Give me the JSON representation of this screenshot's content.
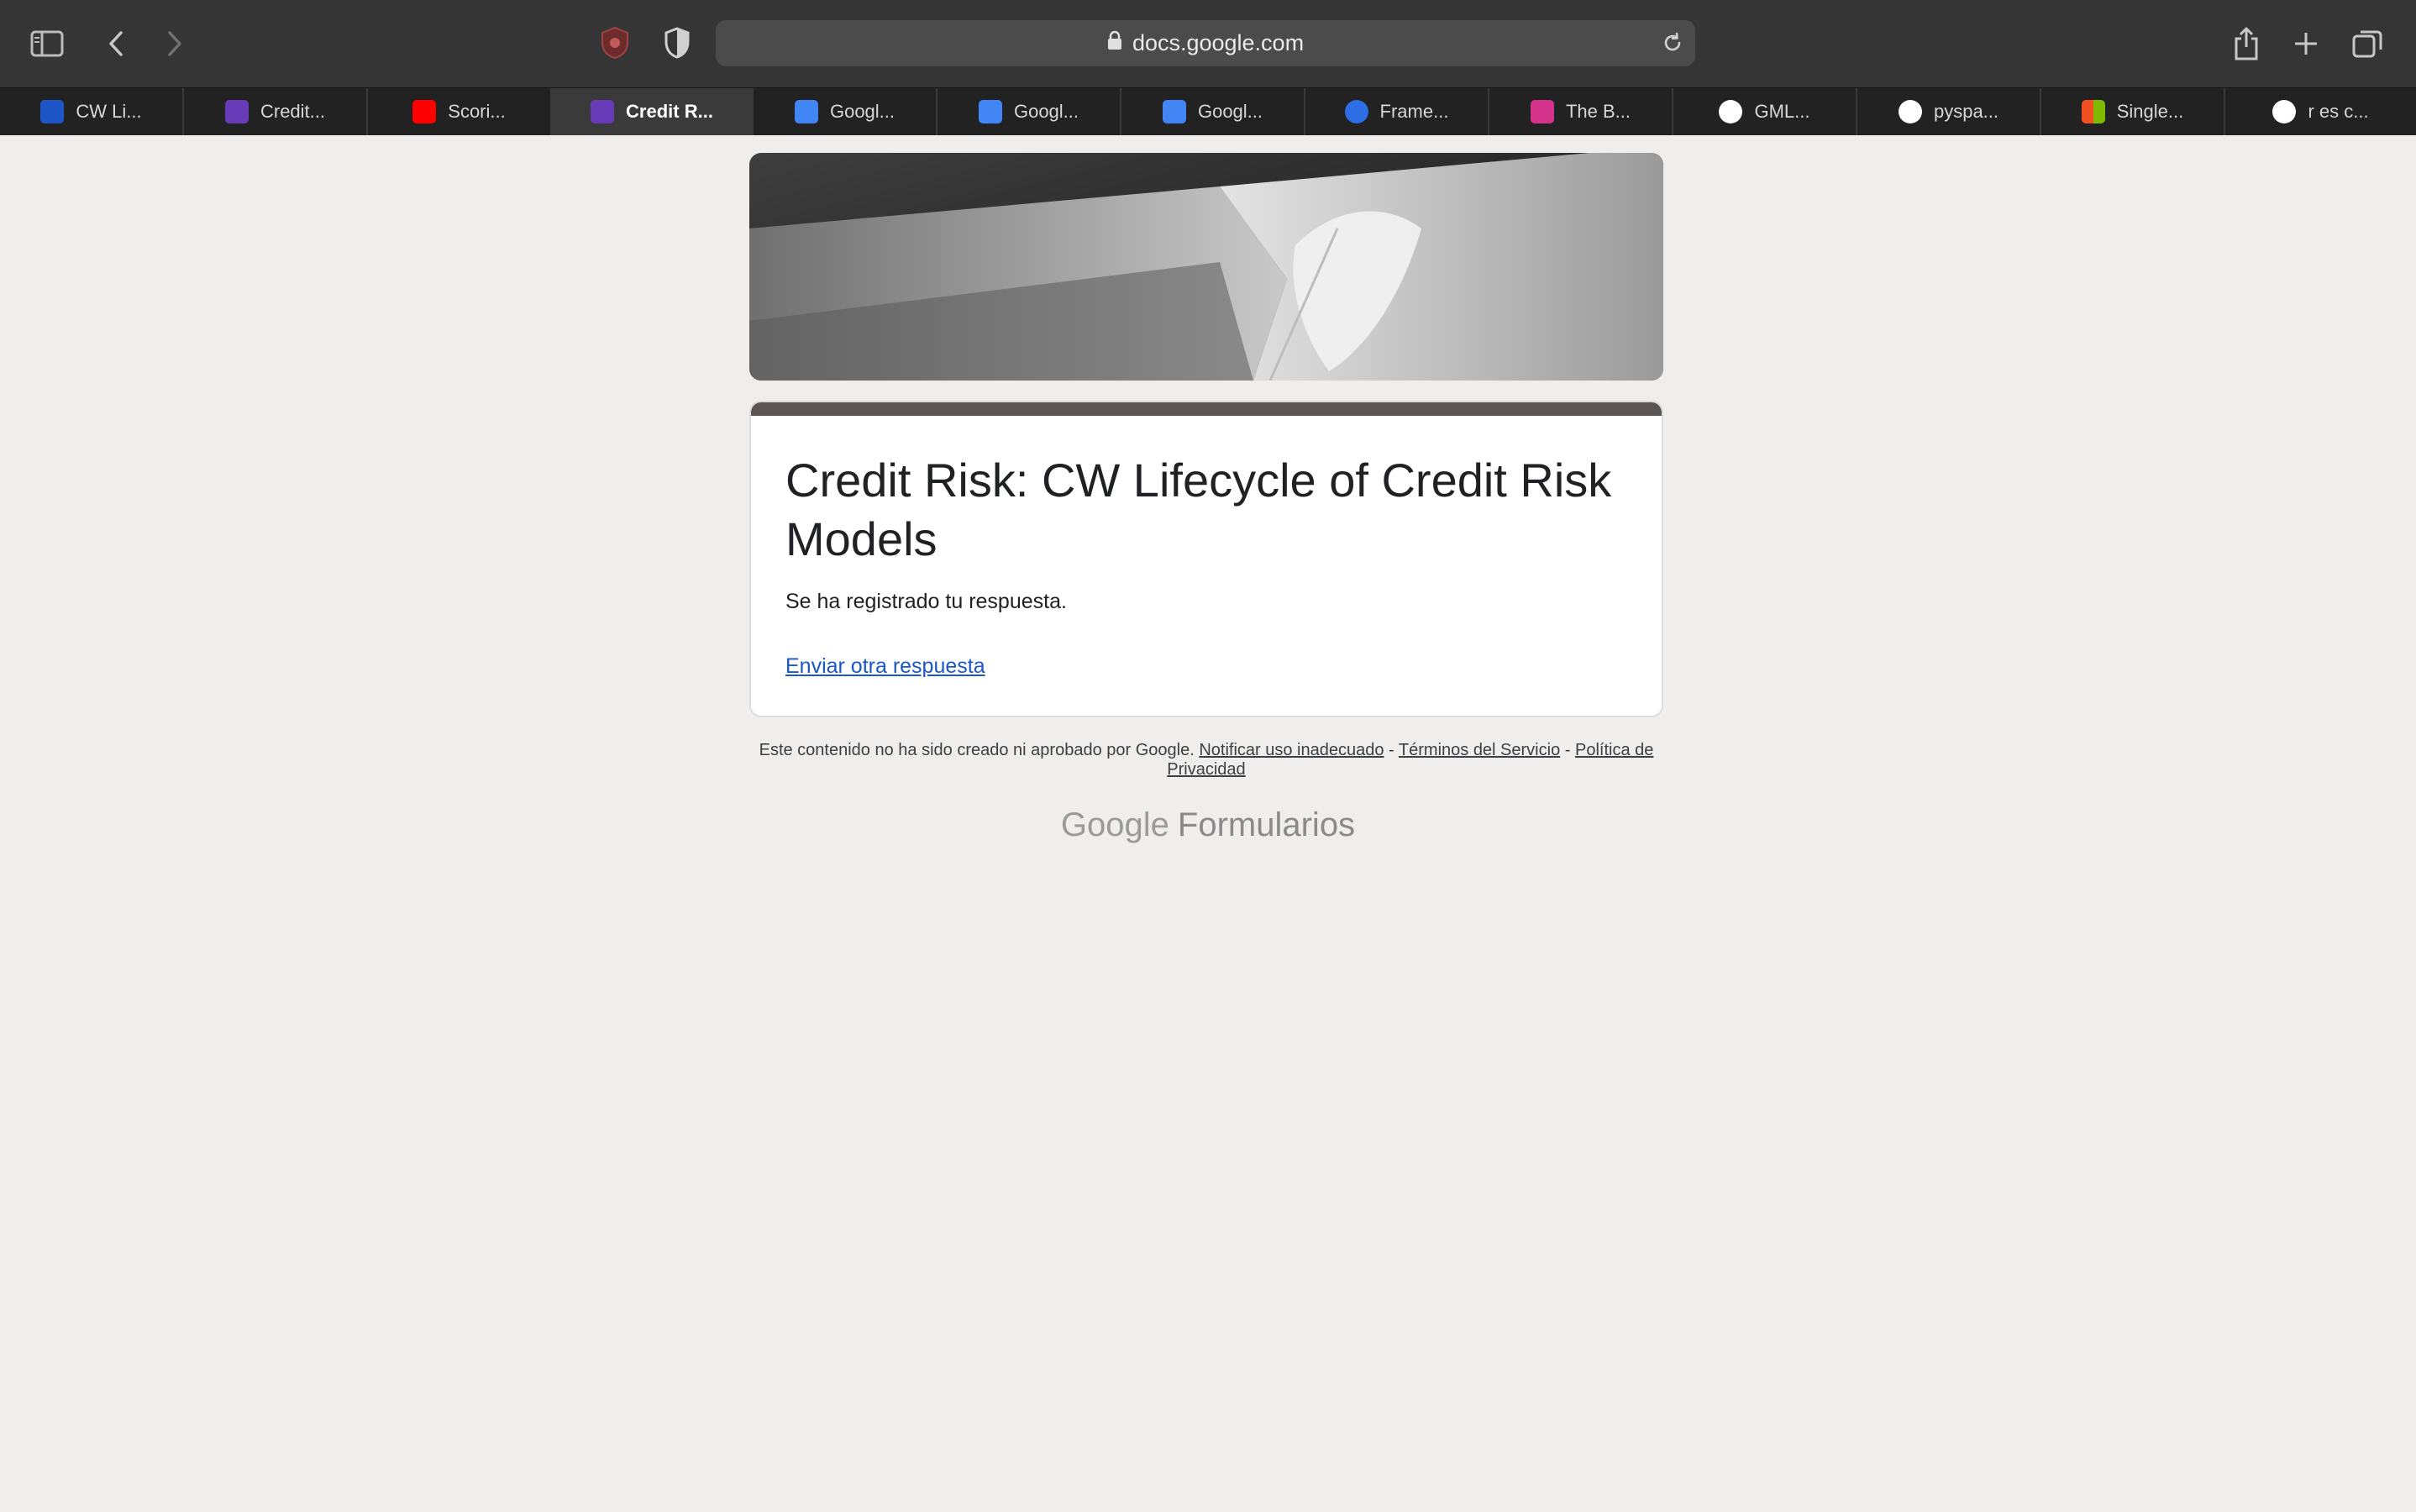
{
  "browser": {
    "url": "docs.google.com",
    "tabs": [
      {
        "label": "CW Li...",
        "icon": "cw-favicon",
        "color": "#1e56c8"
      },
      {
        "label": "Credit...",
        "icon": "google-forms-favicon",
        "color": "#673ab7"
      },
      {
        "label": "Scori...",
        "icon": "youtube-favicon",
        "color": "#ff0000"
      },
      {
        "label": "Credit R...",
        "icon": "google-forms-favicon",
        "color": "#673ab7",
        "active": true
      },
      {
        "label": "Googl...",
        "icon": "google-translate-favicon",
        "color": "#4285f4"
      },
      {
        "label": "Googl...",
        "icon": "google-translate-favicon",
        "color": "#4285f4"
      },
      {
        "label": "Googl...",
        "icon": "google-translate-favicon",
        "color": "#4285f4"
      },
      {
        "label": "Frame...",
        "icon": "framework-favicon",
        "color": "#2d6ee6"
      },
      {
        "label": "The B...",
        "icon": "w-favicon",
        "color": "#d6338c"
      },
      {
        "label": "GML...",
        "icon": "google-favicon",
        "color": "#ffffff"
      },
      {
        "label": "pyspa...",
        "icon": "google-favicon",
        "color": "#ffffff"
      },
      {
        "label": "Single...",
        "icon": "microsoft-favicon",
        "color": "#f25022"
      },
      {
        "label": "r es c...",
        "icon": "google-favicon",
        "color": "#ffffff"
      }
    ]
  },
  "form": {
    "title": "Credit Risk: CW Lifecycle of Credit Risk Models",
    "confirmation": "Se ha registrado tu respuesta.",
    "another_link": "Enviar otra respuesta",
    "accent_color": "#5b5453"
  },
  "footer": {
    "disclaimer": "Este contenido no ha sido creado ni aprobado por Google.",
    "report_link": "Notificar uso inadecuado",
    "sep1": "-",
    "terms_link": "Términos del Servicio",
    "sep2": "-",
    "privacy_link": "Política de Privacidad"
  },
  "branding": {
    "google": "Google",
    "product": "Formularios"
  }
}
